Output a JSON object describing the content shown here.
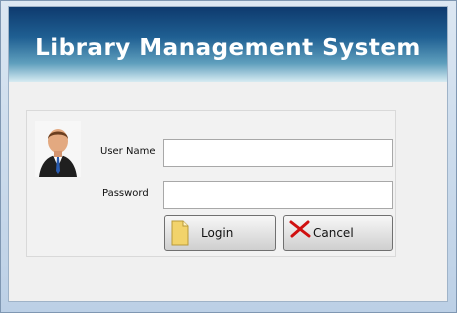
{
  "header": {
    "title": "Library Management System"
  },
  "login_form": {
    "username_label": "User Name",
    "username_value": "",
    "password_label": "Password",
    "password_value": "",
    "login_button": "Login",
    "cancel_button": "Cancel"
  },
  "icons": {
    "avatar": "user-avatar-icon",
    "login": "document-icon",
    "cancel": "red-x-icon"
  },
  "colors": {
    "header_dark": "#0e3a6e",
    "header_light": "#5f9fbd",
    "cancel_icon": "#d01010",
    "login_icon": "#f2d36b"
  }
}
